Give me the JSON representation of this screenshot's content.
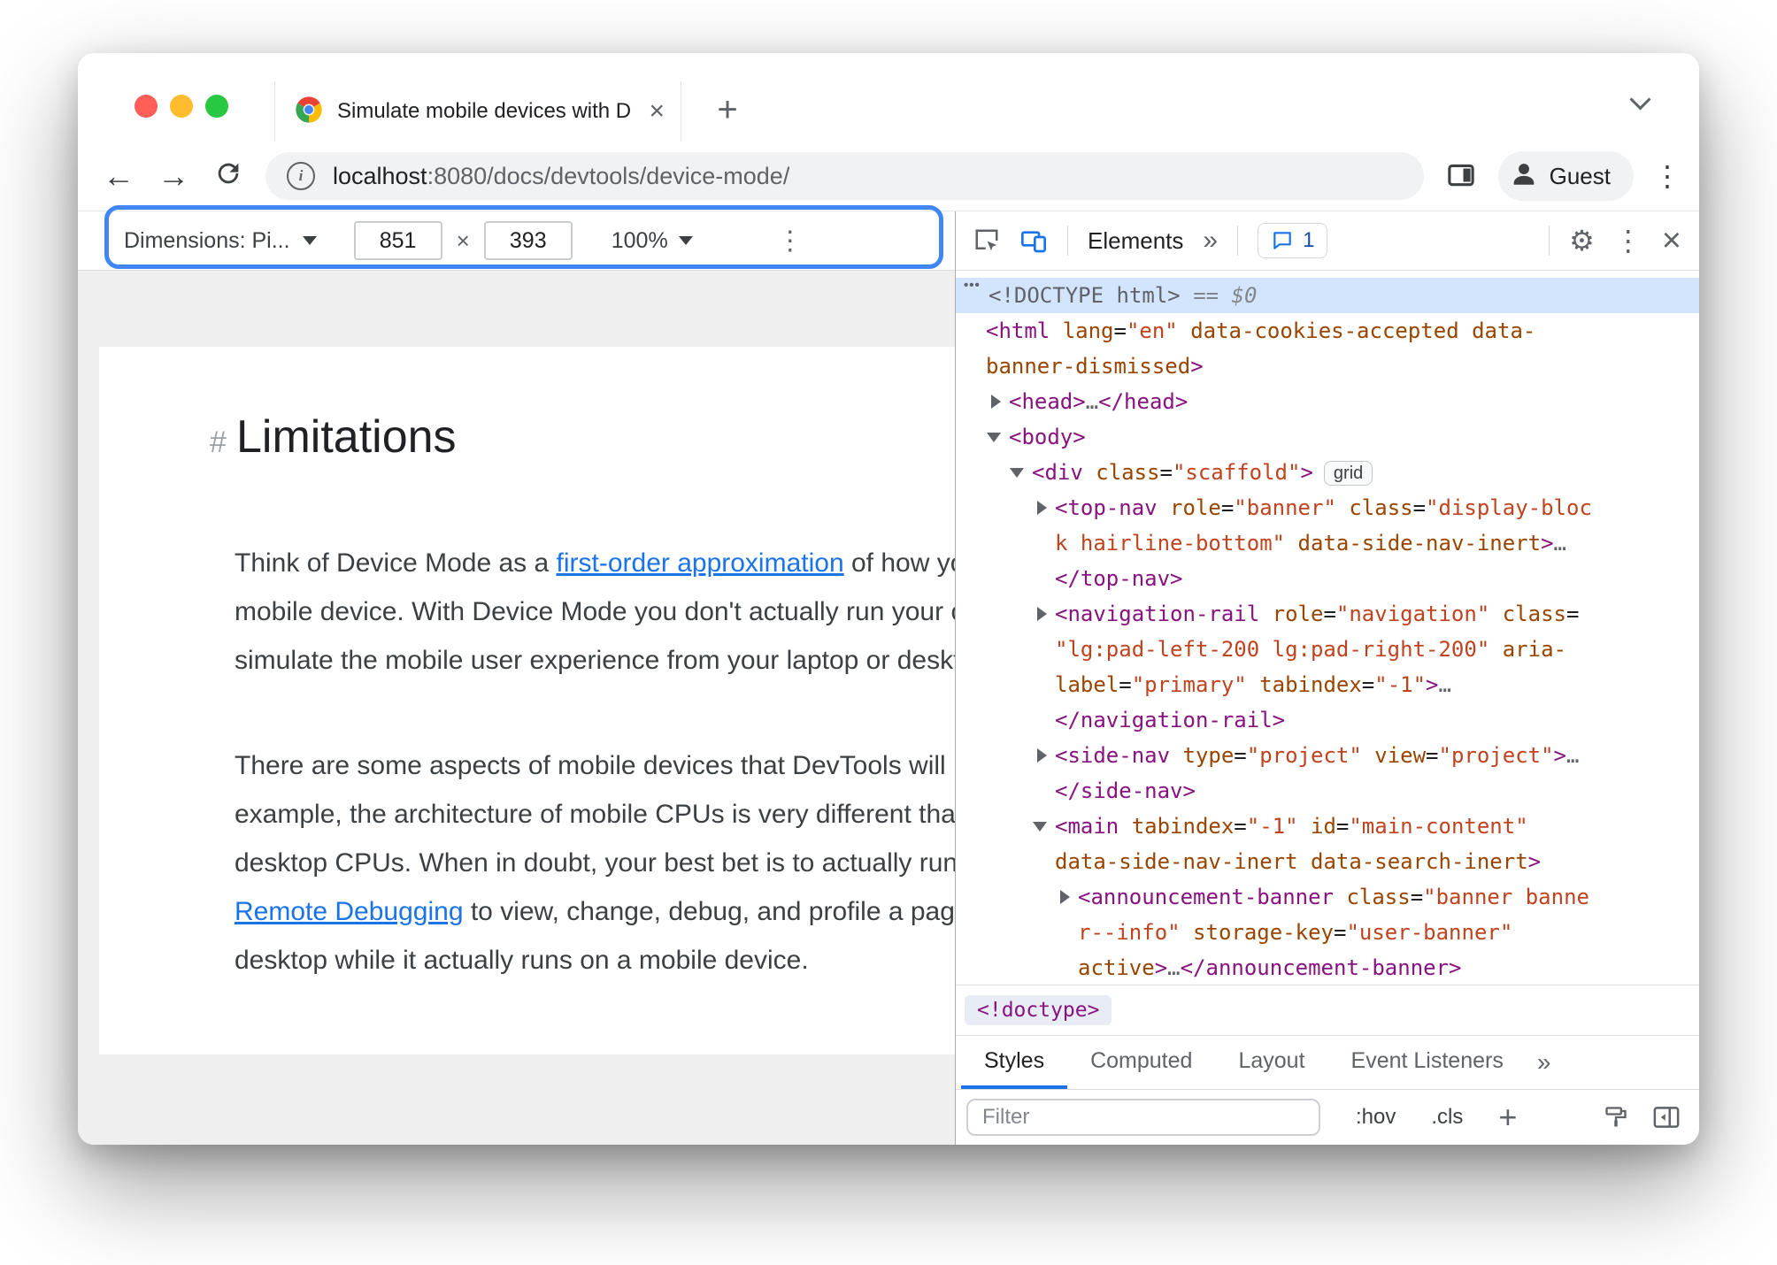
{
  "browser": {
    "tab_title": "Simulate mobile devices with D",
    "url": {
      "host": "localhost",
      "path": ":8080/docs/devtools/device-mode/"
    },
    "guest": "Guest"
  },
  "icons": {
    "back": "←",
    "forward": "→",
    "new_tab": "+",
    "close": "×",
    "more_v": "⋮",
    "more_tabs": "»",
    "gear": "⚙",
    "info": "i"
  },
  "colors": {
    "highlight_ring": "#4285f4",
    "link": "#1a73e8",
    "devtools_accent": "#1a73e8",
    "token_tag": "#881280",
    "token_attribute": "#994500",
    "token_value": "#c0431f",
    "selected_row": "#d3e5fc"
  },
  "device_toolbar": {
    "dimensions": "Dimensions: Pi...",
    "width": "851",
    "x": "×",
    "height": "393",
    "zoom": "100%"
  },
  "content": {
    "hash": "#",
    "heading": "Limitations",
    "p1": [
      [
        [
          "x",
          "Think of Device Mode as a "
        ],
        [
          "l",
          "first-order approximation"
        ],
        [
          "x",
          " of how your page"
        ]
      ],
      [
        [
          "x",
          "mobile device. With Device Mode you don't actually run your code on"
        ]
      ],
      [
        [
          "x",
          "simulate the mobile user experience from your laptop or desktop."
        ]
      ]
    ],
    "p2": [
      [
        [
          "x",
          "There are some aspects of mobile devices that DevTools will never"
        ]
      ],
      [
        [
          "x",
          "example, the architecture of mobile CPUs is very different than the"
        ]
      ],
      [
        [
          "x",
          "desktop CPUs. When in doubt, your best bet is to actually run your"
        ]
      ],
      [
        [
          "l",
          "Remote Debugging"
        ],
        [
          "x",
          " to view, change, debug, and profile a page's"
        ]
      ],
      [
        [
          "x",
          "desktop while it actually runs on a mobile device."
        ]
      ]
    ]
  },
  "devtools": {
    "panel_tab": "Elements",
    "issues_count": "1",
    "node_dots": "•••",
    "breadcrumb": "<!doctype>",
    "sidebar_tabs": [
      "Styles",
      "Computed",
      "Layout",
      "Event Listeners"
    ],
    "filter_placeholder": "Filter",
    "pseudo": ":hov",
    "classes": ".cls",
    "add": "+",
    "dom": [
      {
        "sel": true,
        "dots": true,
        "i": 0,
        "t": [
          [
            "doc",
            "<!DOCTYPE html>"
          ],
          [
            "meta",
            " == $0"
          ]
        ]
      },
      {
        "i": 0,
        "t": [
          [
            "tag",
            "<html"
          ],
          [
            "pln",
            " "
          ],
          [
            "attr",
            "lang"
          ],
          [
            "pln",
            "="
          ],
          [
            "val",
            "\"en\""
          ],
          [
            "pln",
            " "
          ],
          [
            "attr",
            "data-cookies-accepted"
          ],
          [
            "pln",
            " "
          ],
          [
            "attr",
            "data-"
          ]
        ]
      },
      {
        "i": 0,
        "t": [
          [
            "attr",
            "banner-dismissed"
          ],
          [
            "tag",
            ">"
          ]
        ]
      },
      {
        "i": 1,
        "a": "r",
        "t": [
          [
            "tag",
            "<head>"
          ],
          [
            "ell",
            "…"
          ],
          [
            "tag",
            "</head>"
          ]
        ]
      },
      {
        "i": 1,
        "a": "d",
        "t": [
          [
            "tag",
            "<body>"
          ]
        ]
      },
      {
        "i": 2,
        "a": "d",
        "t": [
          [
            "tag",
            "<div"
          ],
          [
            "pln",
            " "
          ],
          [
            "attr",
            "class"
          ],
          [
            "pln",
            "="
          ],
          [
            "val",
            "\"scaffold\""
          ],
          [
            "tag",
            ">"
          ],
          [
            "badge",
            "grid"
          ]
        ]
      },
      {
        "i": 3,
        "a": "r",
        "t": [
          [
            "tag",
            "<top-nav"
          ],
          [
            "pln",
            " "
          ],
          [
            "attr",
            "role"
          ],
          [
            "pln",
            "="
          ],
          [
            "val",
            "\"banner\""
          ],
          [
            "pln",
            " "
          ],
          [
            "attr",
            "class"
          ],
          [
            "pln",
            "="
          ],
          [
            "val",
            "\"display-bloc"
          ]
        ]
      },
      {
        "i": 3,
        "t": [
          [
            "val",
            "k hairline-bottom\""
          ],
          [
            "pln",
            " "
          ],
          [
            "attr",
            "data-side-nav-inert"
          ],
          [
            "tag",
            ">"
          ],
          [
            "ell",
            "…"
          ]
        ]
      },
      {
        "i": 3,
        "t": [
          [
            "tag",
            "</top-nav>"
          ]
        ]
      },
      {
        "i": 3,
        "a": "r",
        "t": [
          [
            "tag",
            "<navigation-rail"
          ],
          [
            "pln",
            " "
          ],
          [
            "attr",
            "role"
          ],
          [
            "pln",
            "="
          ],
          [
            "val",
            "\"navigation\""
          ],
          [
            "pln",
            " "
          ],
          [
            "attr",
            "class"
          ],
          [
            "pln",
            "="
          ]
        ]
      },
      {
        "i": 3,
        "t": [
          [
            "val",
            "\"lg:pad-left-200 lg:pad-right-200\""
          ],
          [
            "pln",
            " "
          ],
          [
            "attr",
            "aria-"
          ]
        ]
      },
      {
        "i": 3,
        "t": [
          [
            "attr",
            "label"
          ],
          [
            "pln",
            "="
          ],
          [
            "val",
            "\"primary\""
          ],
          [
            "pln",
            " "
          ],
          [
            "attr",
            "tabindex"
          ],
          [
            "pln",
            "="
          ],
          [
            "val",
            "\"-1\""
          ],
          [
            "tag",
            ">"
          ],
          [
            "ell",
            "…"
          ]
        ]
      },
      {
        "i": 3,
        "t": [
          [
            "tag",
            "</navigation-rail>"
          ]
        ]
      },
      {
        "i": 3,
        "a": "r",
        "t": [
          [
            "tag",
            "<side-nav"
          ],
          [
            "pln",
            " "
          ],
          [
            "attr",
            "type"
          ],
          [
            "pln",
            "="
          ],
          [
            "val",
            "\"project\""
          ],
          [
            "pln",
            " "
          ],
          [
            "attr",
            "view"
          ],
          [
            "pln",
            "="
          ],
          [
            "val",
            "\"project\""
          ],
          [
            "tag",
            ">"
          ],
          [
            "ell",
            "…"
          ]
        ]
      },
      {
        "i": 3,
        "t": [
          [
            "tag",
            "</side-nav>"
          ]
        ]
      },
      {
        "i": 3,
        "a": "d",
        "t": [
          [
            "tag",
            "<main"
          ],
          [
            "pln",
            " "
          ],
          [
            "attr",
            "tabindex"
          ],
          [
            "pln",
            "="
          ],
          [
            "val",
            "\"-1\""
          ],
          [
            "pln",
            " "
          ],
          [
            "attr",
            "id"
          ],
          [
            "pln",
            "="
          ],
          [
            "val",
            "\"main-content\""
          ]
        ]
      },
      {
        "i": 3,
        "t": [
          [
            "attr",
            "data-side-nav-inert"
          ],
          [
            "pln",
            " "
          ],
          [
            "attr",
            "data-search-inert"
          ],
          [
            "tag",
            ">"
          ]
        ]
      },
      {
        "i": 4,
        "a": "r",
        "t": [
          [
            "tag",
            "<announcement-banner"
          ],
          [
            "pln",
            " "
          ],
          [
            "attr",
            "class"
          ],
          [
            "pln",
            "="
          ],
          [
            "val",
            "\"banner banne"
          ]
        ]
      },
      {
        "i": 4,
        "t": [
          [
            "val",
            "r--info\""
          ],
          [
            "pln",
            " "
          ],
          [
            "attr",
            "storage-key"
          ],
          [
            "pln",
            "="
          ],
          [
            "val",
            "\"user-banner\""
          ]
        ]
      },
      {
        "i": 4,
        "t": [
          [
            "attr",
            "active"
          ],
          [
            "tag",
            ">"
          ],
          [
            "ell",
            "…"
          ],
          [
            "tag",
            "</announcement-banner>"
          ]
        ]
      }
    ]
  }
}
